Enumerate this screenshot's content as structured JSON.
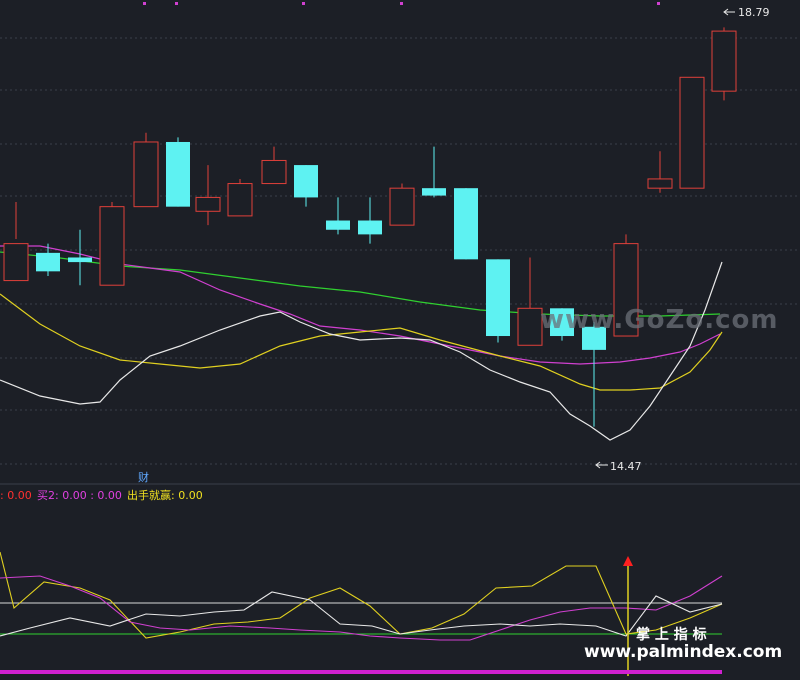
{
  "colors": {
    "background": "#1c1f26",
    "grid": "#3a3f4a",
    "up": "#e0403a",
    "down": "#5ef2f2",
    "ma_white": "#e8e8e8",
    "ma_yellow": "#e0d020",
    "ma_magenta": "#d040d0",
    "ma_green": "#30d030",
    "label_red": "#ff3030",
    "label_magenta": "#e040e0",
    "label_yellow": "#f0e020",
    "label_blue": "#60a8ff",
    "bottom_bar": "#d020d0"
  },
  "price_labels": {
    "high": "18.79",
    "low": "14.47"
  },
  "indicator_labels": {
    "fragment": ": 0.00",
    "buy2": "买2: 0.00 : 0.00",
    "shoot_win": "出手就赢: 0.00",
    "cai": "财"
  },
  "watermarks": {
    "gozo": "www.GoZo.com",
    "palm_cn": "掌 上 指 标",
    "palm_url": "www.palmindex.com"
  },
  "chart_data": {
    "type": "candlestick",
    "ylim": [
      14.0,
      19.0
    ],
    "candles": [
      {
        "o": 16.45,
        "h": 16.9,
        "l": 16.5,
        "c": 16.05,
        "dir": "up"
      },
      {
        "o": 16.35,
        "h": 16.45,
        "l": 16.1,
        "c": 16.15,
        "dir": "down"
      },
      {
        "o": 16.3,
        "h": 16.6,
        "l": 16.0,
        "c": 16.25,
        "dir": "down"
      },
      {
        "o": 16.0,
        "h": 16.9,
        "l": 16.0,
        "c": 16.85,
        "dir": "up"
      },
      {
        "o": 16.85,
        "h": 17.65,
        "l": 16.85,
        "c": 17.55,
        "dir": "up"
      },
      {
        "o": 17.55,
        "h": 17.6,
        "l": 16.85,
        "c": 16.85,
        "dir": "down"
      },
      {
        "o": 16.8,
        "h": 17.3,
        "l": 16.65,
        "c": 16.95,
        "dir": "up"
      },
      {
        "o": 16.75,
        "h": 17.15,
        "l": 16.75,
        "c": 17.1,
        "dir": "up"
      },
      {
        "o": 17.1,
        "h": 17.5,
        "l": 17.1,
        "c": 17.35,
        "dir": "up"
      },
      {
        "o": 17.3,
        "h": 17.3,
        "l": 16.85,
        "c": 16.95,
        "dir": "down"
      },
      {
        "o": 16.7,
        "h": 16.95,
        "l": 16.55,
        "c": 16.6,
        "dir": "down"
      },
      {
        "o": 16.7,
        "h": 16.95,
        "l": 16.45,
        "c": 16.55,
        "dir": "down"
      },
      {
        "o": 16.65,
        "h": 17.1,
        "l": 16.65,
        "c": 17.05,
        "dir": "up"
      },
      {
        "o": 17.05,
        "h": 17.5,
        "l": 16.95,
        "c": 16.97,
        "dir": "down"
      },
      {
        "o": 17.05,
        "h": 17.05,
        "l": 16.28,
        "c": 16.28,
        "dir": "down"
      },
      {
        "o": 16.28,
        "h": 16.28,
        "l": 15.38,
        "c": 15.45,
        "dir": "down"
      },
      {
        "o": 15.75,
        "h": 16.3,
        "l": 15.35,
        "c": 15.35,
        "dir": "up"
      },
      {
        "o": 15.75,
        "h": 15.75,
        "l": 15.4,
        "c": 15.45,
        "dir": "down"
      },
      {
        "o": 15.55,
        "h": 15.6,
        "l": 14.47,
        "c": 15.3,
        "dir": "down"
      },
      {
        "o": 15.45,
        "h": 16.55,
        "l": 15.45,
        "c": 16.45,
        "dir": "up"
      },
      {
        "o": 17.05,
        "h": 17.45,
        "l": 17.0,
        "c": 17.15,
        "dir": "up"
      },
      {
        "o": 17.05,
        "h": 18.25,
        "l": 17.05,
        "c": 18.25,
        "dir": "up"
      },
      {
        "o": 18.1,
        "h": 18.79,
        "l": 18.0,
        "c": 18.75,
        "dir": "up"
      }
    ]
  }
}
